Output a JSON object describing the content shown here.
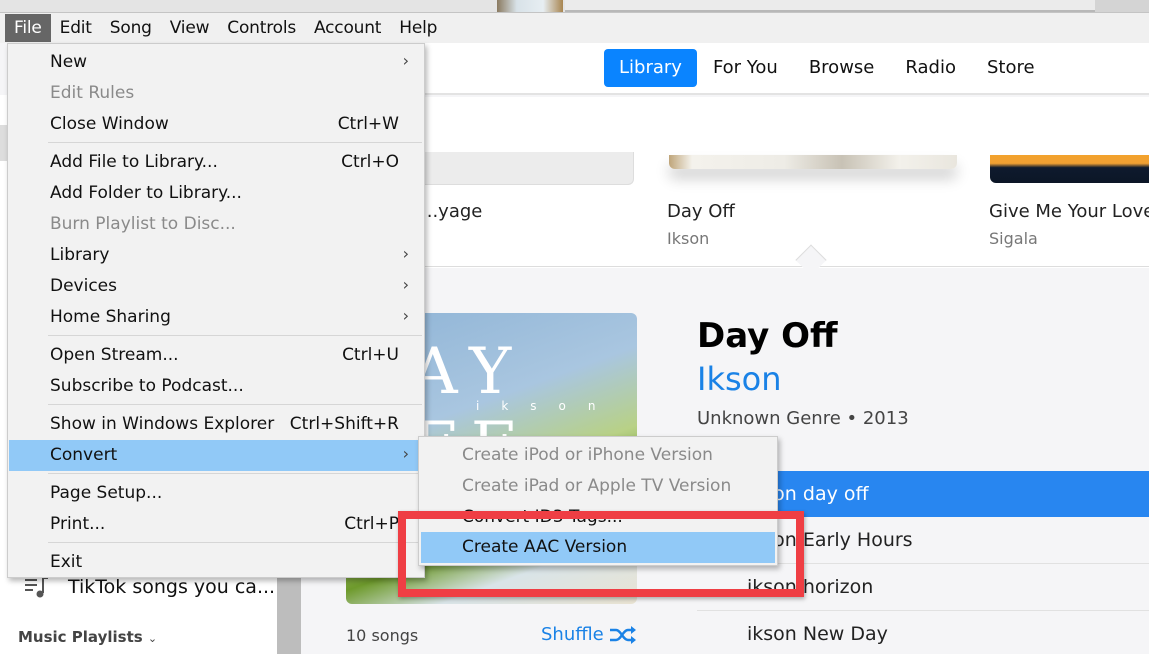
{
  "menubar": {
    "items": [
      "File",
      "Edit",
      "Song",
      "View",
      "Controls",
      "Account",
      "Help"
    ],
    "active": "File"
  },
  "nav": {
    "tabs": [
      "Library",
      "For You",
      "Browse",
      "Radio",
      "Store"
    ],
    "active": "Library"
  },
  "recent": [
    {
      "title": "...yage",
      "artist": ""
    },
    {
      "title": "Day Off",
      "artist": "Ikson"
    },
    {
      "title": "Give Me Your Love",
      "artist": "Sigala"
    }
  ],
  "album": {
    "cover_title": "DAY OFF",
    "cover_sub": "ikson",
    "title": "Day Off",
    "artist": "Ikson",
    "meta": "Unknown Genre • 2013",
    "song_count": "10 songs",
    "shuffle_label": "Shuffle",
    "tracks": [
      "ikson day off",
      "ikson Early Hours",
      "ikson horizon",
      "ikson New Day"
    ],
    "selected_track": 0
  },
  "sidebar": {
    "playlist_item": "TikTok songs you ca...",
    "section_label": "Music Playlists"
  },
  "file_menu": {
    "items": [
      {
        "label": "New",
        "shortcut": "",
        "submenu": true,
        "disabled": false
      },
      {
        "label": "Edit Rules",
        "shortcut": "",
        "submenu": false,
        "disabled": true
      },
      {
        "label": "Close Window",
        "shortcut": "Ctrl+W",
        "submenu": false,
        "disabled": false
      },
      {
        "label": "Add File to Library...",
        "shortcut": "Ctrl+O",
        "submenu": false,
        "disabled": false
      },
      {
        "label": "Add Folder to Library...",
        "shortcut": "",
        "submenu": false,
        "disabled": false
      },
      {
        "label": "Burn Playlist to Disc...",
        "shortcut": "",
        "submenu": false,
        "disabled": true
      },
      {
        "label": "Library",
        "shortcut": "",
        "submenu": true,
        "disabled": false
      },
      {
        "label": "Devices",
        "shortcut": "",
        "submenu": true,
        "disabled": false
      },
      {
        "label": "Home Sharing",
        "shortcut": "",
        "submenu": true,
        "disabled": false
      },
      {
        "label": "Open Stream...",
        "shortcut": "Ctrl+U",
        "submenu": false,
        "disabled": false
      },
      {
        "label": "Subscribe to Podcast...",
        "shortcut": "",
        "submenu": false,
        "disabled": false
      },
      {
        "label": "Show in Windows Explorer",
        "shortcut": "Ctrl+Shift+R",
        "submenu": false,
        "disabled": false
      },
      {
        "label": "Convert",
        "shortcut": "",
        "submenu": true,
        "disabled": false,
        "highlighted": true
      },
      {
        "label": "Page Setup...",
        "shortcut": "",
        "submenu": false,
        "disabled": false
      },
      {
        "label": "Print...",
        "shortcut": "Ctrl+P",
        "submenu": false,
        "disabled": false
      },
      {
        "label": "Exit",
        "shortcut": "",
        "submenu": false,
        "disabled": false
      }
    ]
  },
  "convert_submenu": {
    "items": [
      {
        "label": "Create iPod or iPhone Version",
        "disabled": true
      },
      {
        "label": "Create iPad or Apple TV Version",
        "disabled": true
      },
      {
        "label": "Convert ID3 Tags...",
        "disabled": false
      },
      {
        "label": "Create AAC Version",
        "disabled": false,
        "highlighted": true
      }
    ]
  },
  "annotation": {
    "color": "#ef3e44",
    "target": "Create AAC Version"
  },
  "colors": {
    "accent": "#0a84ff",
    "artist_link": "#1a82e6",
    "selected_row": "#2886f0",
    "menu_highlight": "#91c9f7"
  }
}
